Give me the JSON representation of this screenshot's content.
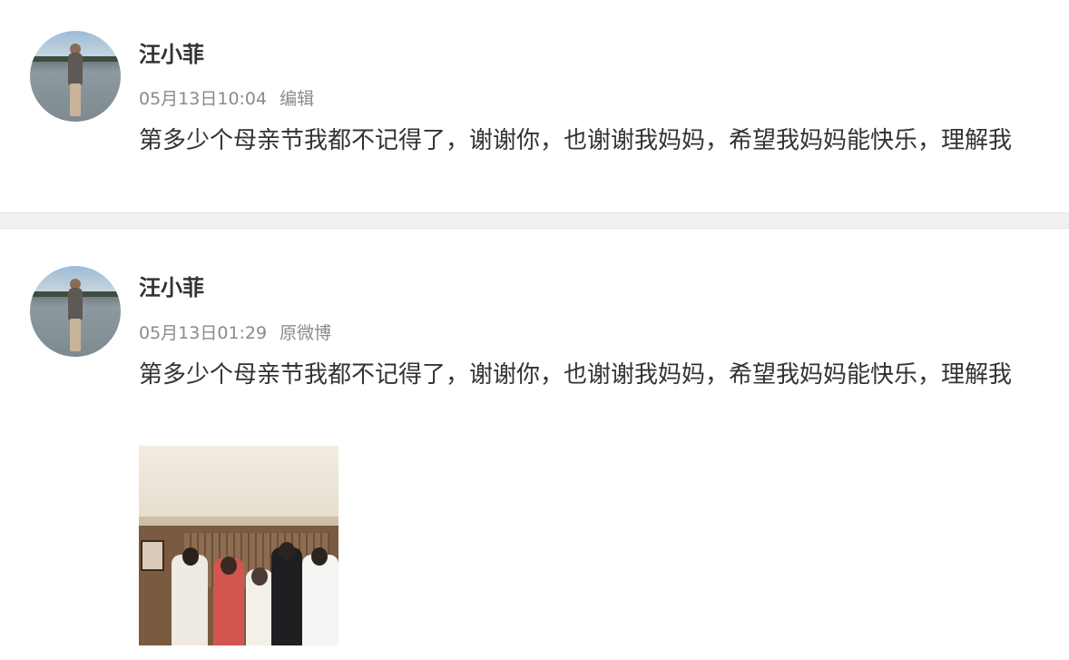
{
  "posts": [
    {
      "author": "汪小菲",
      "time": "05月13日10:04",
      "action": "编辑",
      "text": "第多少个母亲节我都不记得了，谢谢你，也谢谢我妈妈，希望我妈妈能快乐，理解我"
    },
    {
      "author": "汪小菲",
      "time": "05月13日01:29",
      "action": "原微博",
      "text": "第多少个母亲节我都不记得了，谢谢你，也谢谢我妈妈，希望我妈妈能快乐，理解我",
      "has_photo": true
    }
  ],
  "colors": {
    "name": "#333333",
    "meta": "#8a8a8a",
    "divider": "#f0f0f2"
  }
}
